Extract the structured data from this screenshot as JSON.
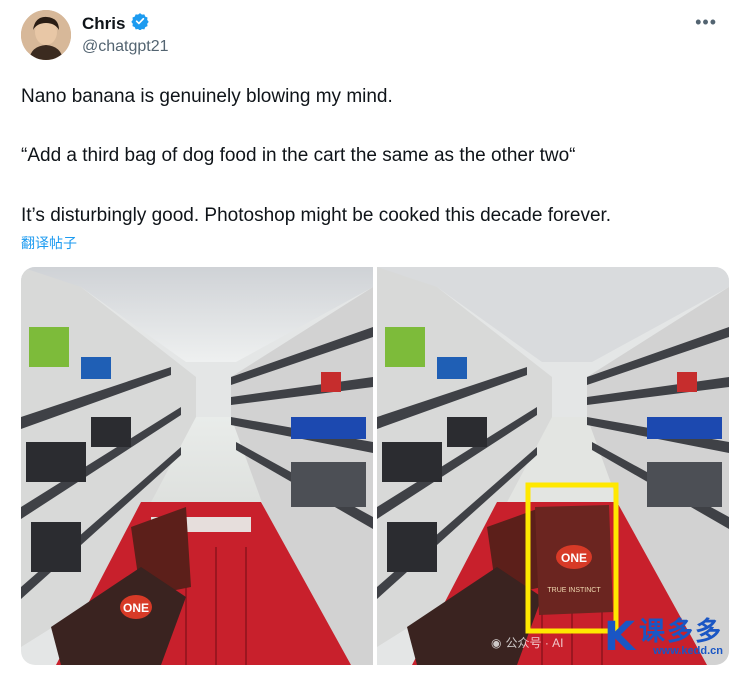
{
  "author": {
    "name": "Chris",
    "handle": "@chatgpt21",
    "verified": true
  },
  "tweet": {
    "line1": "Nano banana is genuinely blowing my mind.",
    "line2": "“Add a third bag of dog food in the cart the same as the other two“",
    "line3": "It’s disturbingly good. Photoshop might be cooked this decade forever.",
    "translate_label": "翻译帖子"
  },
  "media": {
    "left_image_bag_label": "ONE",
    "right_image_bag_label": "ONE",
    "right_image_bag_sublabel": "TRUE INSTINCT",
    "highlight_color": "#ffe800",
    "cart_color": "#c8202c"
  },
  "watermark": {
    "wechat_text": "公众号 · AI",
    "logo_letter": "K",
    "site_cn": "课多多",
    "site_url": "www.kedd.cn"
  },
  "colors": {
    "link": "#1d9bf0",
    "verified": "#1d9bf0",
    "secondary_text": "#536471"
  },
  "icons": {
    "verified": "verified-badge-icon",
    "more": "more-options-icon"
  }
}
